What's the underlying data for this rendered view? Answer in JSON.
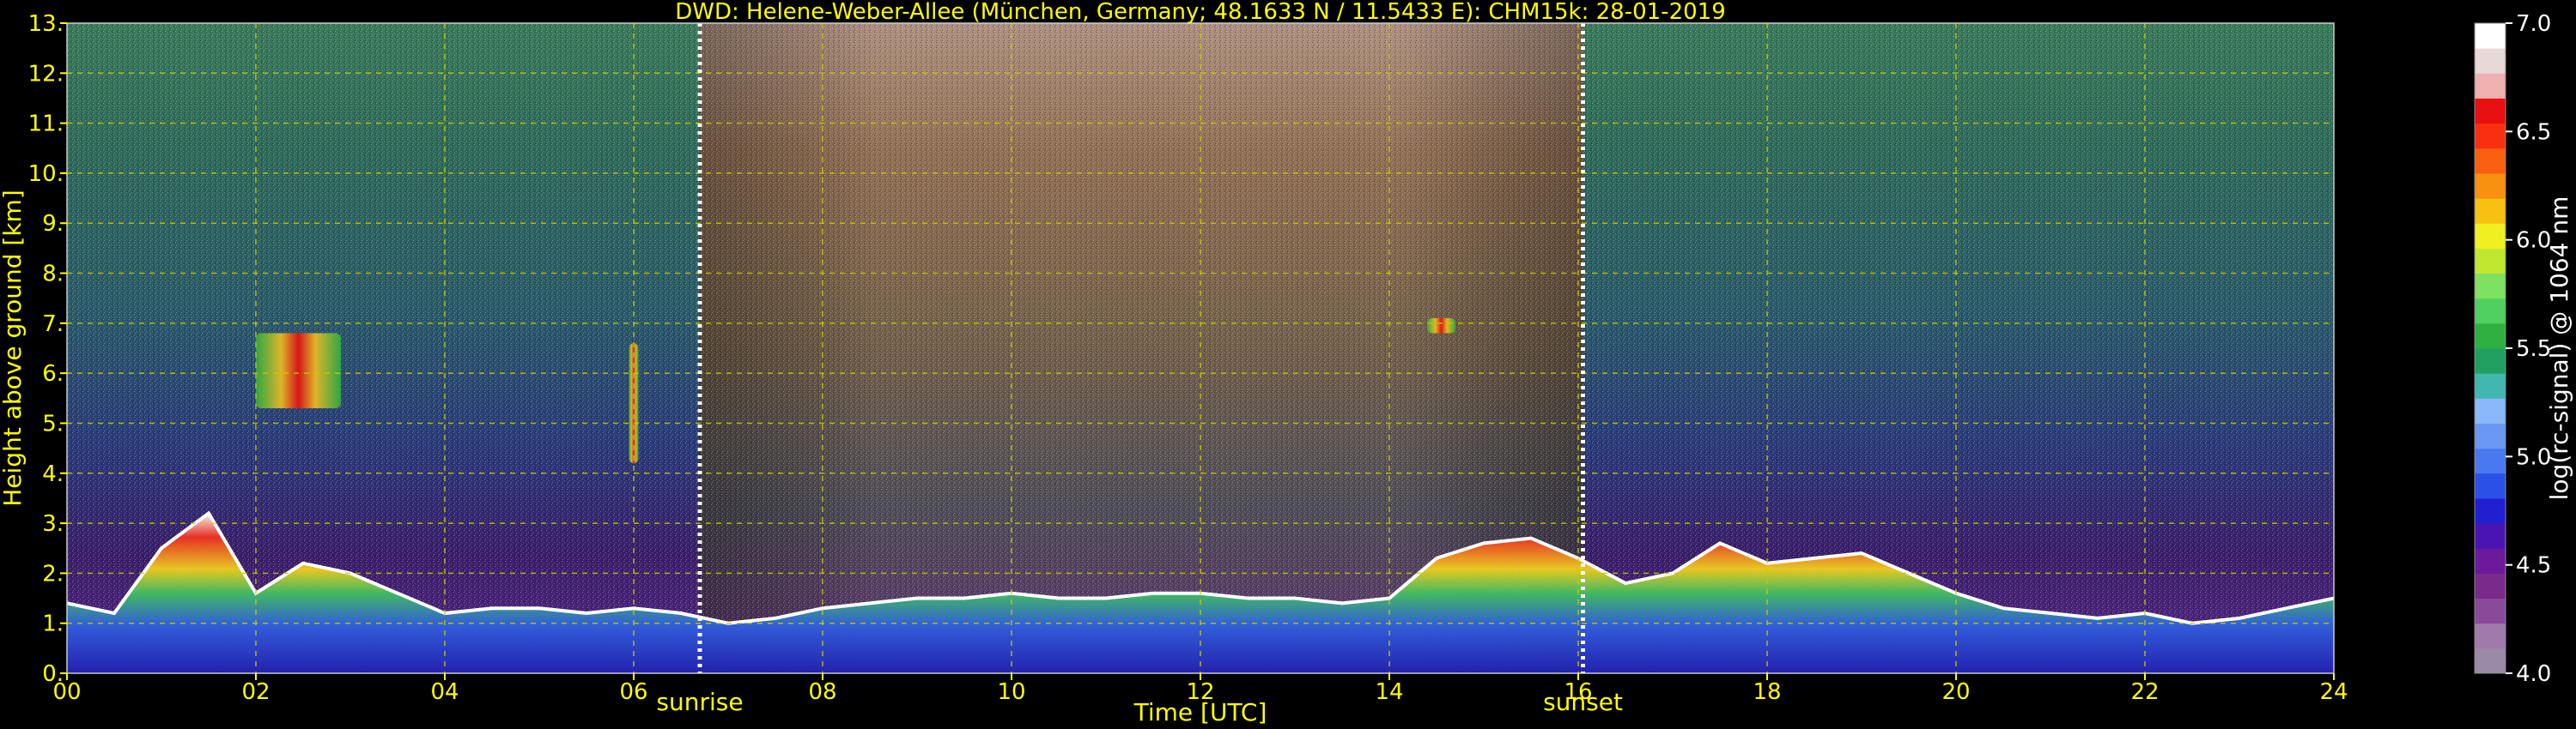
{
  "chart_data": {
    "type": "heatmap",
    "title": "DWD: Helene-Weber-Allee (München, Germany; 48.1633 N / 11.5433 E):    CHM15k: 28-01-2019",
    "xlabel": "Time [UTC]",
    "ylabel": "Height above ground [km]",
    "xlim": [
      0,
      24
    ],
    "ylim": [
      0,
      13
    ],
    "x_ticks": [
      0,
      2,
      4,
      6,
      8,
      10,
      12,
      14,
      16,
      18,
      20,
      22,
      24
    ],
    "x_tick_labels": [
      "00",
      "02",
      "04",
      "06",
      "08",
      "10",
      "12",
      "14",
      "16",
      "18",
      "20",
      "22",
      "24"
    ],
    "y_ticks": [
      0,
      1,
      2,
      3,
      4,
      5,
      6,
      7,
      8,
      9,
      10,
      11,
      12,
      13
    ],
    "y_tick_labels": [
      "0.",
      "1.",
      "2.",
      "3.",
      "4.",
      "5.",
      "6.",
      "7.",
      "8.",
      "9.",
      "10.",
      "11.",
      "12.",
      "13."
    ],
    "grid": true,
    "sunrise": {
      "x": 6.7,
      "label": "sunrise"
    },
    "sunset": {
      "x": 16.05,
      "label": "sunset"
    },
    "colorbar": {
      "label": "log(rc-signal) @ 1064 nm",
      "min": 4.0,
      "max": 7.0,
      "ticks": [
        4.0,
        4.5,
        5.0,
        5.5,
        6.0,
        6.5,
        7.0
      ],
      "tick_labels": [
        "4.0",
        "4.5",
        "5.0",
        "5.5",
        "6.0",
        "6.5",
        "7.0"
      ],
      "colors": [
        "#9a8aa8",
        "#a07aaa",
        "#8a4a9a",
        "#7a2a8a",
        "#6a1a9a",
        "#4a14b4",
        "#2020d0",
        "#2a50e8",
        "#4a78f0",
        "#6a98f4",
        "#8ab8f8",
        "#40b8b0",
        "#20a060",
        "#30b040",
        "#50d060",
        "#80e060",
        "#c0e830",
        "#f0f020",
        "#f8c010",
        "#f89010",
        "#f86010",
        "#f83010",
        "#e81010",
        "#f0b0b0",
        "#e8d8d8",
        "#ffffff"
      ]
    },
    "boundary_layer_top_km": {
      "x": [
        0,
        0.5,
        1.0,
        1.5,
        2.0,
        2.5,
        3.0,
        3.5,
        4.0,
        4.5,
        5.0,
        5.5,
        6.0,
        6.5,
        7.0,
        7.5,
        8.0,
        8.5,
        9.0,
        9.5,
        10.0,
        10.5,
        11.0,
        11.5,
        12.0,
        12.5,
        13.0,
        13.5,
        14.0,
        14.5,
        15.0,
        15.5,
        16.0,
        16.5,
        17.0,
        17.5,
        18.0,
        18.5,
        19.0,
        19.5,
        20.0,
        20.5,
        21.0,
        21.5,
        22.0,
        22.5,
        23.0,
        23.5,
        24.0
      ],
      "y": [
        1.4,
        1.2,
        2.5,
        3.2,
        1.6,
        2.2,
        2.0,
        1.6,
        1.2,
        1.3,
        1.3,
        1.2,
        1.3,
        1.2,
        1.0,
        1.1,
        1.3,
        1.4,
        1.5,
        1.5,
        1.6,
        1.5,
        1.5,
        1.6,
        1.6,
        1.5,
        1.5,
        1.4,
        1.5,
        2.3,
        2.6,
        2.7,
        2.3,
        1.8,
        2.0,
        2.6,
        2.2,
        2.3,
        2.4,
        2.0,
        1.6,
        1.3,
        1.2,
        1.1,
        1.2,
        1.0,
        1.1,
        1.3,
        1.5
      ]
    },
    "cloud_patches": [
      {
        "x0": 2.0,
        "x1": 2.9,
        "y0": 5.3,
        "y1": 6.8
      },
      {
        "x0": 5.95,
        "x1": 6.05,
        "y0": 4.2,
        "y1": 6.6
      },
      {
        "x0": 14.4,
        "x1": 14.7,
        "y0": 6.8,
        "y1": 7.1
      }
    ]
  }
}
